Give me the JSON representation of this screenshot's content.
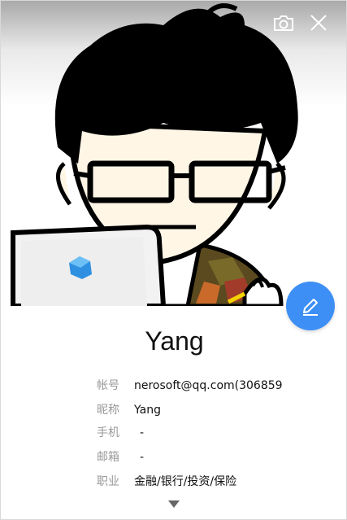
{
  "profile": {
    "name": "Yang"
  },
  "fields": [
    {
      "label": "帐号",
      "value": "nerosoft@qq.com(306859"
    },
    {
      "label": "昵称",
      "value": "Yang"
    },
    {
      "label": "手机",
      "value": "-"
    },
    {
      "label": "邮箱",
      "value": "-"
    },
    {
      "label": "职业",
      "value": "金融/银行/投资/保险"
    }
  ],
  "colors": {
    "accent": "#3d8ff5"
  },
  "icons": {
    "camera": "camera-icon",
    "close": "close-icon",
    "edit": "pencil-icon",
    "expand": "chevron-down-icon"
  }
}
